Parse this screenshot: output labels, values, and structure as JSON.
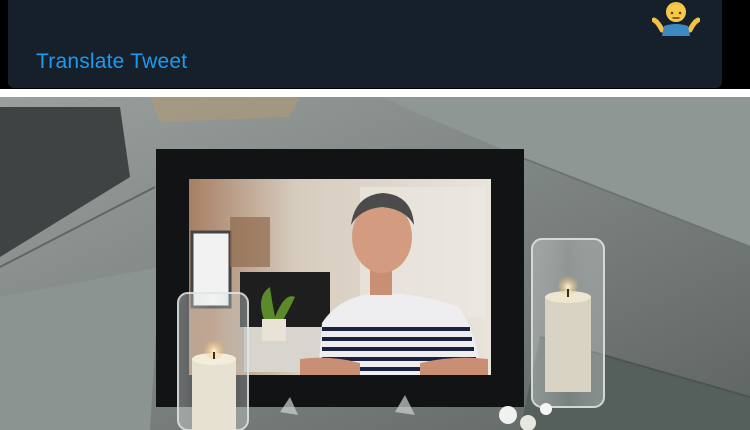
{
  "tweet": {
    "translate_label": "Translate Tweet",
    "emoji_icon": "person-shrugging-emoji-icon"
  },
  "photo": {
    "subject": "memorial-photo-frame-with-candles"
  },
  "colors": {
    "tweet_background": "#15202b",
    "link_blue": "#1d9bf0",
    "separator": "#ffffff"
  }
}
